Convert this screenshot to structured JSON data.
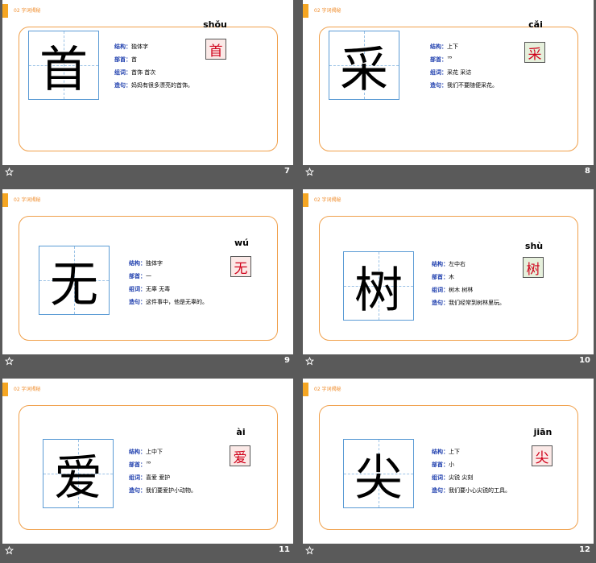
{
  "section_label": "02  字词揭秘",
  "labels": {
    "structure": "结构：",
    "radical": "部首：",
    "words": "组词：",
    "sentence": "造句："
  },
  "colors": {
    "accent": "#f5a623",
    "card_border": "#f0a04b",
    "label_blue": "#1f3fae",
    "grid_blue": "#5b9bd5",
    "char_red": "#d0021b"
  },
  "slides": [
    {
      "number": "7",
      "character": "首",
      "pinyin": "shǒu",
      "structure": "独体字",
      "radical": "首",
      "words": "首饰   首次",
      "sentence": "妈妈有很多漂亮的首饰。"
    },
    {
      "number": "8",
      "character": "采",
      "pinyin": "cǎi",
      "structure": "上下",
      "radical": "爫",
      "words": "采花   采访",
      "sentence": "我们不要随便采花。"
    },
    {
      "number": "9",
      "character": "无",
      "pinyin": "wú",
      "structure": "独体字",
      "radical": "一",
      "words": "无辜   无毒",
      "sentence": "这件事中，他是无辜的。"
    },
    {
      "number": "10",
      "character": "树",
      "pinyin": "shù",
      "structure": "左中右",
      "radical": "木",
      "words": "树木   树林",
      "sentence": "我们经常到树林里玩。"
    },
    {
      "number": "11",
      "character": "爱",
      "pinyin": "ài",
      "structure": "上中下",
      "radical": "爫",
      "words": "喜爱   爱护",
      "sentence": "我们要爱护小动物。"
    },
    {
      "number": "12",
      "character": "尖",
      "pinyin": "jiān",
      "structure": "上下",
      "radical": "小",
      "words": "尖锐   尖刻",
      "sentence": "我们要小心尖锐的工具。"
    }
  ]
}
